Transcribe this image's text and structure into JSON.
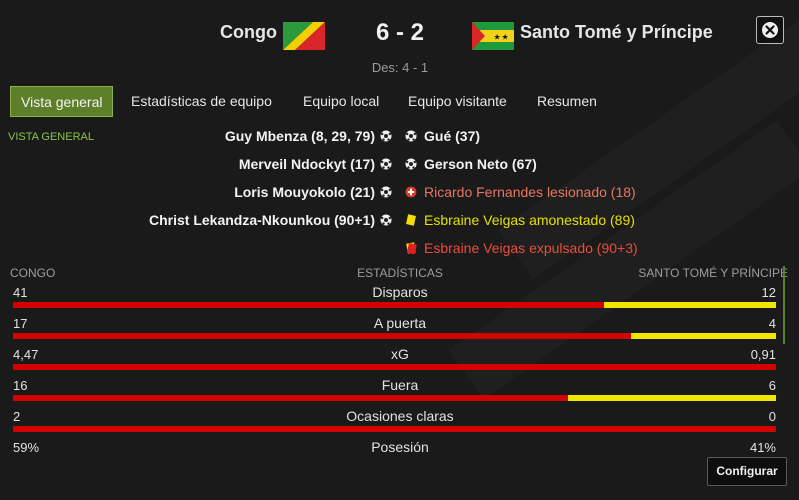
{
  "header": {
    "home_team": "Congo",
    "away_team": "Santo Tomé y Príncipe",
    "score": "6 - 2",
    "halftime": "Des: 4 - 1",
    "close_icon": "close-icon"
  },
  "tabs": [
    {
      "label": "Vista general",
      "active": true
    },
    {
      "label": "Estadísticas de equipo",
      "active": false
    },
    {
      "label": "Equipo local",
      "active": false
    },
    {
      "label": "Equipo visitante",
      "active": false
    },
    {
      "label": "Resumen",
      "active": false
    }
  ],
  "overview": {
    "section_title": "VISTA GENERAL",
    "home_events": [
      {
        "text": "Guy Mbenza (8, 29, 79)",
        "icon": "goal-ball-icon"
      },
      {
        "text": "Merveil Ndockyt (17)",
        "icon": "goal-ball-icon"
      },
      {
        "text": "Loris Mouyokolo (21)",
        "icon": "goal-ball-icon"
      },
      {
        "text": "Christ Lekandza-Nkounkou (90+1)",
        "icon": "goal-ball-icon"
      }
    ],
    "away_events": [
      {
        "text": "Gué (37)",
        "icon": "goal-ball-icon"
      },
      {
        "text": "Gerson Neto (67)",
        "icon": "goal-ball-icon"
      },
      {
        "text": "Ricardo Fernandes lesionado (18)",
        "icon": "injury-icon"
      },
      {
        "text": "Esbraine Veigas amonestado (89)",
        "icon": "yellow-card-icon"
      },
      {
        "text": "Esbraine Veigas expulsado (90+3)",
        "icon": "red-card-icon"
      }
    ]
  },
  "stats": {
    "home_header": "CONGO",
    "center_header": "ESTADÍSTICAS",
    "away_header": "SANTO TOMÉ Y PRÍNCIPE",
    "rows": [
      {
        "label": "Disparos",
        "home": "41",
        "away": "12",
        "home_share": 0.774
      },
      {
        "label": "A puerta",
        "home": "17",
        "away": "4",
        "home_share": 0.81
      },
      {
        "label": "xG",
        "home": "4,47",
        "away": "0,91",
        "home_share": 1.0
      },
      {
        "label": "Fuera",
        "home": "16",
        "away": "6",
        "home_share": 0.727
      },
      {
        "label": "Ocasiones claras",
        "home": "2",
        "away": "0",
        "home_share": 1.0
      },
      {
        "label": "Posesión",
        "home": "59%",
        "away": "41%",
        "home_share": null
      }
    ]
  },
  "footer": {
    "configure_label": "Configurar"
  },
  "colors": {
    "home_bar": "#d40000",
    "away_bar": "#f2e600",
    "accent": "#5d7f2a"
  }
}
